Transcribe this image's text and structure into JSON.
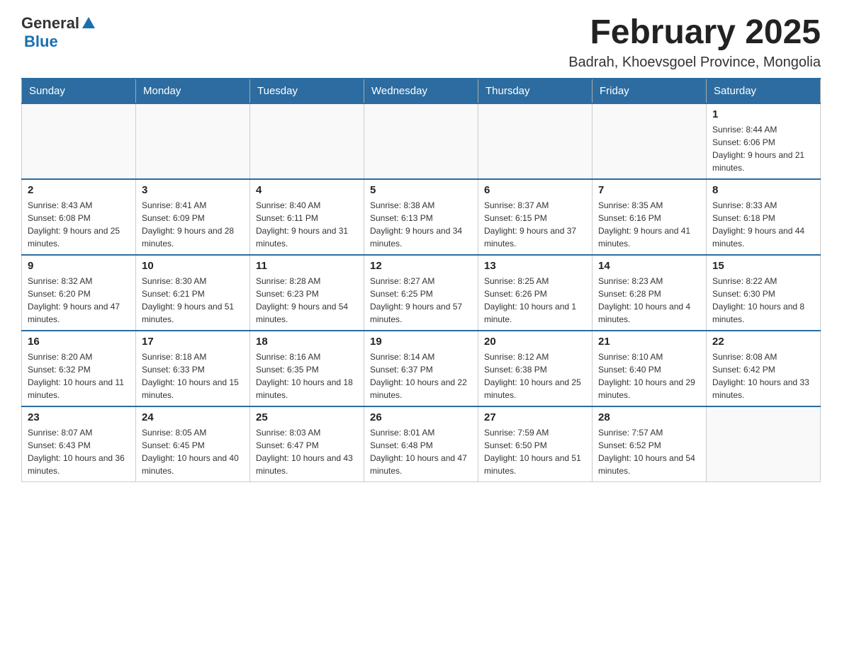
{
  "logo": {
    "general": "General",
    "blue": "Blue"
  },
  "header": {
    "title": "February 2025",
    "location": "Badrah, Khoevsgoel Province, Mongolia"
  },
  "weekdays": [
    "Sunday",
    "Monday",
    "Tuesday",
    "Wednesday",
    "Thursday",
    "Friday",
    "Saturday"
  ],
  "weeks": [
    [
      {
        "day": "",
        "info": ""
      },
      {
        "day": "",
        "info": ""
      },
      {
        "day": "",
        "info": ""
      },
      {
        "day": "",
        "info": ""
      },
      {
        "day": "",
        "info": ""
      },
      {
        "day": "",
        "info": ""
      },
      {
        "day": "1",
        "info": "Sunrise: 8:44 AM\nSunset: 6:06 PM\nDaylight: 9 hours and 21 minutes."
      }
    ],
    [
      {
        "day": "2",
        "info": "Sunrise: 8:43 AM\nSunset: 6:08 PM\nDaylight: 9 hours and 25 minutes."
      },
      {
        "day": "3",
        "info": "Sunrise: 8:41 AM\nSunset: 6:09 PM\nDaylight: 9 hours and 28 minutes."
      },
      {
        "day": "4",
        "info": "Sunrise: 8:40 AM\nSunset: 6:11 PM\nDaylight: 9 hours and 31 minutes."
      },
      {
        "day": "5",
        "info": "Sunrise: 8:38 AM\nSunset: 6:13 PM\nDaylight: 9 hours and 34 minutes."
      },
      {
        "day": "6",
        "info": "Sunrise: 8:37 AM\nSunset: 6:15 PM\nDaylight: 9 hours and 37 minutes."
      },
      {
        "day": "7",
        "info": "Sunrise: 8:35 AM\nSunset: 6:16 PM\nDaylight: 9 hours and 41 minutes."
      },
      {
        "day": "8",
        "info": "Sunrise: 8:33 AM\nSunset: 6:18 PM\nDaylight: 9 hours and 44 minutes."
      }
    ],
    [
      {
        "day": "9",
        "info": "Sunrise: 8:32 AM\nSunset: 6:20 PM\nDaylight: 9 hours and 47 minutes."
      },
      {
        "day": "10",
        "info": "Sunrise: 8:30 AM\nSunset: 6:21 PM\nDaylight: 9 hours and 51 minutes."
      },
      {
        "day": "11",
        "info": "Sunrise: 8:28 AM\nSunset: 6:23 PM\nDaylight: 9 hours and 54 minutes."
      },
      {
        "day": "12",
        "info": "Sunrise: 8:27 AM\nSunset: 6:25 PM\nDaylight: 9 hours and 57 minutes."
      },
      {
        "day": "13",
        "info": "Sunrise: 8:25 AM\nSunset: 6:26 PM\nDaylight: 10 hours and 1 minute."
      },
      {
        "day": "14",
        "info": "Sunrise: 8:23 AM\nSunset: 6:28 PM\nDaylight: 10 hours and 4 minutes."
      },
      {
        "day": "15",
        "info": "Sunrise: 8:22 AM\nSunset: 6:30 PM\nDaylight: 10 hours and 8 minutes."
      }
    ],
    [
      {
        "day": "16",
        "info": "Sunrise: 8:20 AM\nSunset: 6:32 PM\nDaylight: 10 hours and 11 minutes."
      },
      {
        "day": "17",
        "info": "Sunrise: 8:18 AM\nSunset: 6:33 PM\nDaylight: 10 hours and 15 minutes."
      },
      {
        "day": "18",
        "info": "Sunrise: 8:16 AM\nSunset: 6:35 PM\nDaylight: 10 hours and 18 minutes."
      },
      {
        "day": "19",
        "info": "Sunrise: 8:14 AM\nSunset: 6:37 PM\nDaylight: 10 hours and 22 minutes."
      },
      {
        "day": "20",
        "info": "Sunrise: 8:12 AM\nSunset: 6:38 PM\nDaylight: 10 hours and 25 minutes."
      },
      {
        "day": "21",
        "info": "Sunrise: 8:10 AM\nSunset: 6:40 PM\nDaylight: 10 hours and 29 minutes."
      },
      {
        "day": "22",
        "info": "Sunrise: 8:08 AM\nSunset: 6:42 PM\nDaylight: 10 hours and 33 minutes."
      }
    ],
    [
      {
        "day": "23",
        "info": "Sunrise: 8:07 AM\nSunset: 6:43 PM\nDaylight: 10 hours and 36 minutes."
      },
      {
        "day": "24",
        "info": "Sunrise: 8:05 AM\nSunset: 6:45 PM\nDaylight: 10 hours and 40 minutes."
      },
      {
        "day": "25",
        "info": "Sunrise: 8:03 AM\nSunset: 6:47 PM\nDaylight: 10 hours and 43 minutes."
      },
      {
        "day": "26",
        "info": "Sunrise: 8:01 AM\nSunset: 6:48 PM\nDaylight: 10 hours and 47 minutes."
      },
      {
        "day": "27",
        "info": "Sunrise: 7:59 AM\nSunset: 6:50 PM\nDaylight: 10 hours and 51 minutes."
      },
      {
        "day": "28",
        "info": "Sunrise: 7:57 AM\nSunset: 6:52 PM\nDaylight: 10 hours and 54 minutes."
      },
      {
        "day": "",
        "info": ""
      }
    ]
  ]
}
